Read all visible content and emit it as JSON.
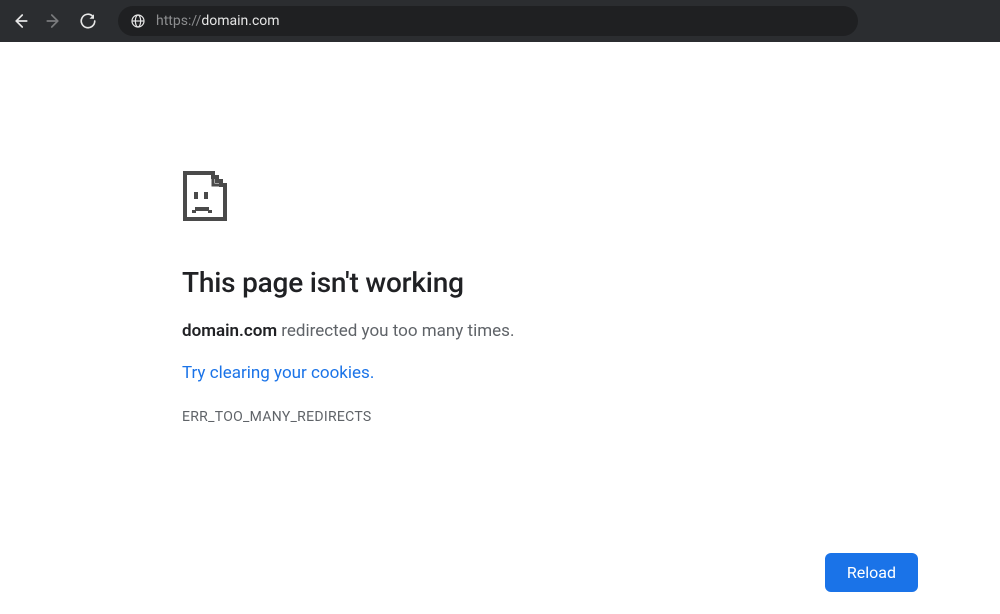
{
  "toolbar": {
    "url_scheme": "https://",
    "url_host": "domain.com"
  },
  "error": {
    "heading": "This page isn't working",
    "domain": "domain.com",
    "message_suffix": " redirected you too many times.",
    "suggestion": "Try clearing your cookies.",
    "code": "ERR_TOO_MANY_REDIRECTS",
    "reload_label": "Reload"
  }
}
